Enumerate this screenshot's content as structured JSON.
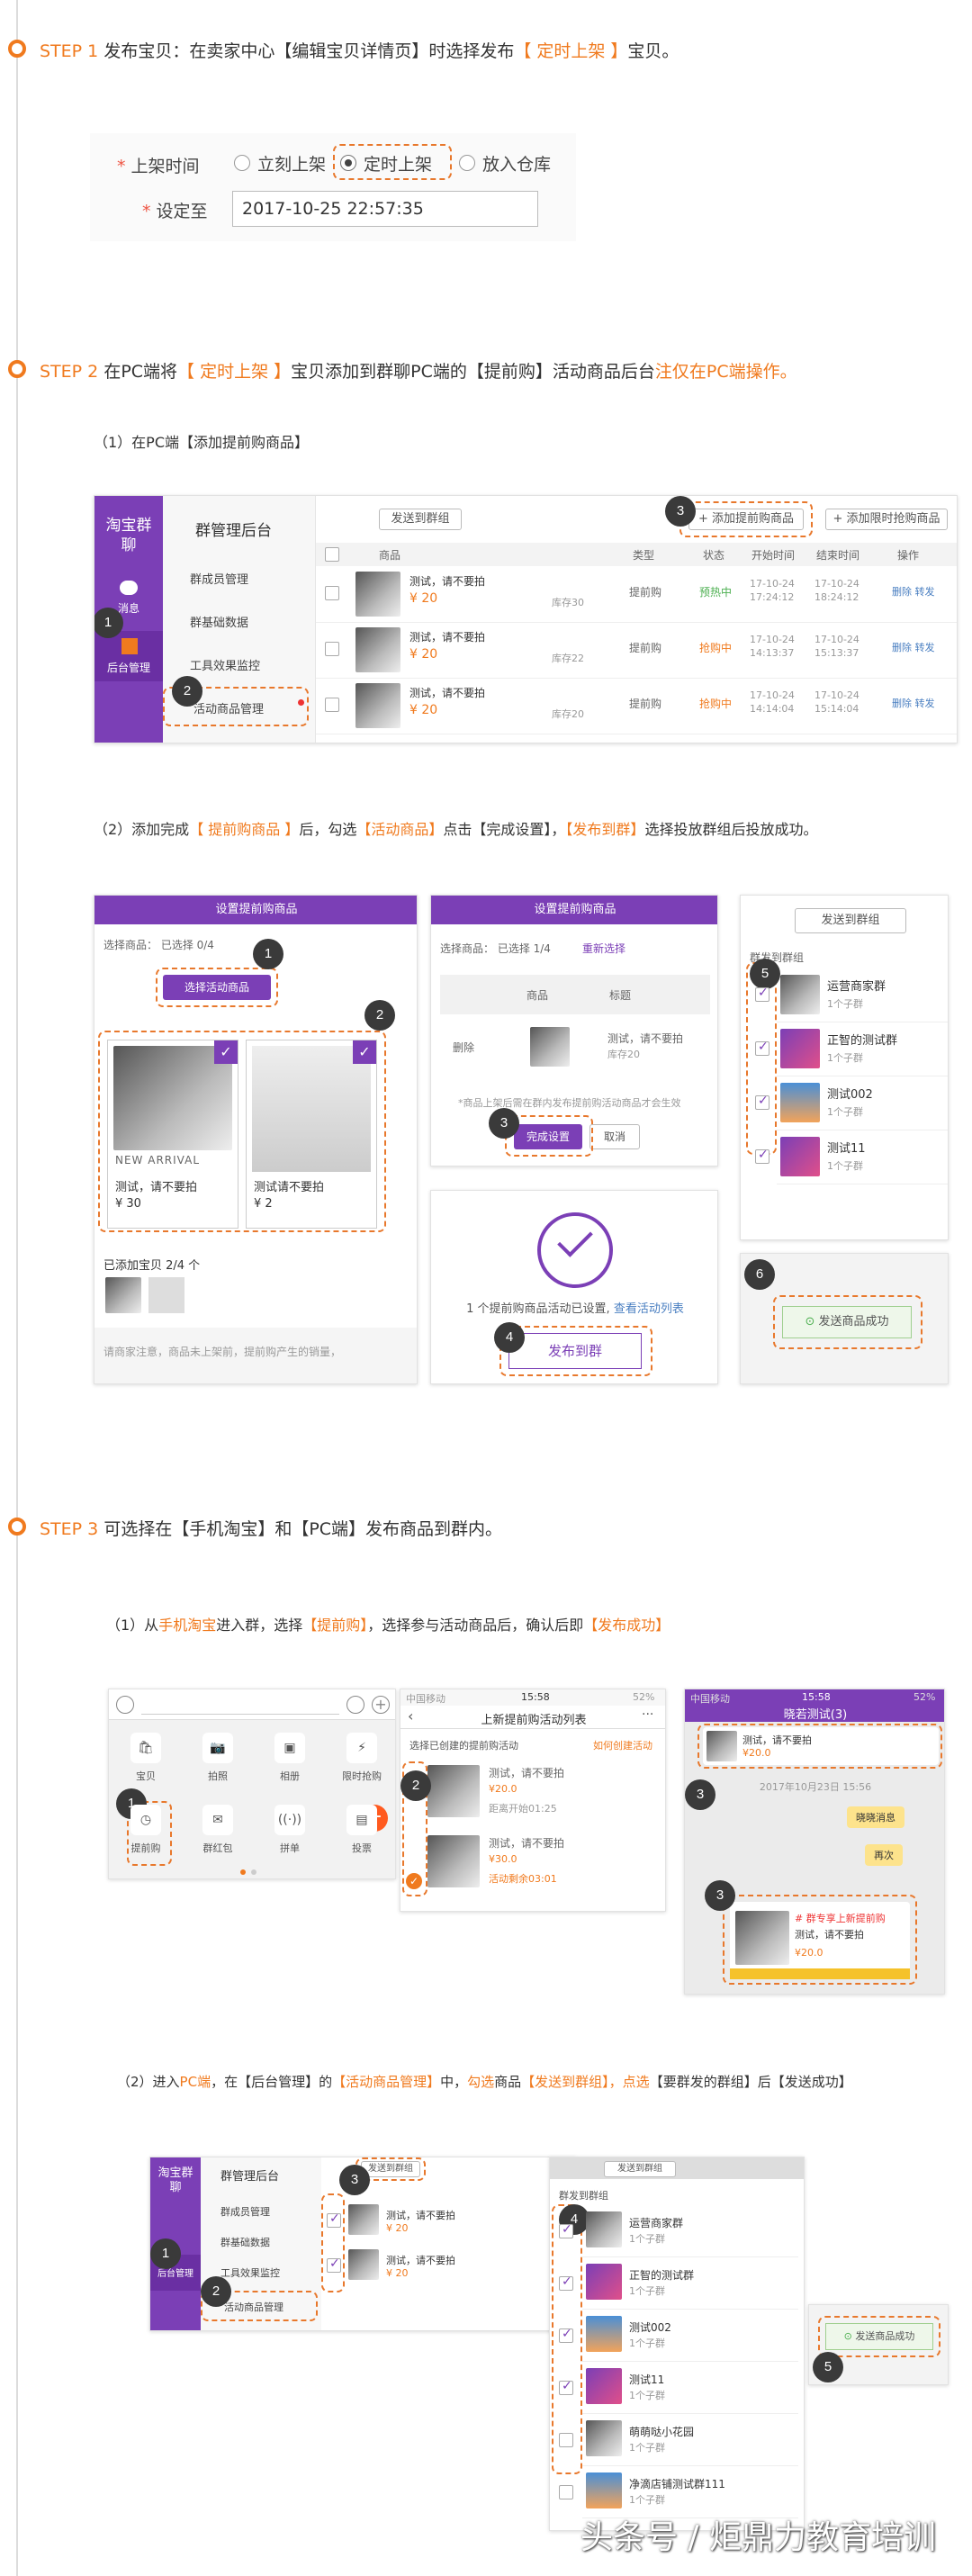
{
  "steps": [
    {
      "label": "STEP 1",
      "text_a": "发布宝贝：在卖家中心【编辑宝贝详情页】时选择发布",
      "highlight": "【 定时上架 】",
      "text_b": "宝贝。"
    },
    {
      "label": "STEP 2",
      "text_a": "在PC端将",
      "highlight": "【 定时上架 】",
      "text_b": "宝贝添加到群聊PC端的【提前购】活动商品后台",
      "note": "注仅在PC端操作。"
    },
    {
      "label": "STEP 3",
      "text": "可选择在【手机淘宝】和【PC端】发布商品到群内。"
    }
  ],
  "step1_form": {
    "shelf_label": "上架时间",
    "opt_now": "立刻上架",
    "opt_timed": "定时上架",
    "opt_store": "放入仓库",
    "set_label": "设定至",
    "datetime": "2017-10-25 22:57:35"
  },
  "step2": {
    "sub1": "（1）在PC端【添加提前购商品】",
    "sub2_a": "（2）添加完成",
    "sub2_h1": "【 提前购商品 】",
    "sub2_b": "后，勾选",
    "sub2_h2": "【活动商品】",
    "sub2_c": "点击【完成设置】，",
    "sub2_h3": "【发布到群】",
    "sub2_d": "选择投放群组后投放成功。"
  },
  "admin": {
    "logo": "淘宝群聊",
    "title": "群管理后台",
    "side_msg": "消息",
    "side_admin": "后台管理",
    "menu": [
      "群成员管理",
      "群基础数据",
      "工具效果监控",
      "活动商品管理"
    ],
    "btn_send": "发送到群组",
    "btn_add": "+ 添加提前购商品",
    "btn_add_flash": "+ 添加限时抢购商品",
    "cols": [
      "商品",
      "类型",
      "状态",
      "开始时间",
      "结束时间",
      "操作"
    ],
    "rows": [
      {
        "name": "测试，请不要拍",
        "price": "¥ 20",
        "stock": "库存30",
        "type": "提前购",
        "status": "预热中",
        "start": "17-10-24 17:24:12",
        "end": "17-10-24 18:24:12",
        "ops": "删除 转发"
      },
      {
        "name": "测试，请不要拍",
        "price": "¥ 20",
        "stock": "库存22",
        "type": "提前购",
        "status": "抢购中",
        "start": "17-10-24 14:13:37",
        "end": "17-10-24 15:13:37",
        "ops": "删除 转发"
      },
      {
        "name": "测试，请不要拍",
        "price": "¥ 20",
        "stock": "库存20",
        "type": "提前购",
        "status": "抢购中",
        "start": "17-10-24 14:14:04",
        "end": "17-10-24 15:14:04",
        "ops": "删除 转发"
      }
    ]
  },
  "setup": {
    "header": "设置提前购商品",
    "selected": "选择商品： 已选择 0/4",
    "btn_select": "选择活动商品",
    "p1_name": "测试，请不要拍",
    "p1_price": "¥ 30",
    "p1_tag": "NEW ARRIVAL",
    "p2_name": "测试请不要拍",
    "p2_price": "¥ 2",
    "added": "已添加宝贝 2/4 个",
    "notice": "请商家注意，商品未上架前，提前购产生的销量，",
    "selected2": "选择商品：  已选择 1/4",
    "reselect": "重新选择",
    "col_goods": "商品",
    "col_title": "标题",
    "row_del": "删除",
    "row_title": "测试，请不要拍",
    "row_stock": "库存20",
    "hint": "*商品上架后需在群内发布提前购活动商品才会生效",
    "btn_done": "完成设置",
    "btn_cancel": "取消",
    "success_text": "1 个提前购商品活动已设置,",
    "success_link": "查看活动列表",
    "btn_publish": "发布到群"
  },
  "group_panel": {
    "header": "发送到群组",
    "title": "群发到群组",
    "groups": [
      {
        "name": "运营商家群",
        "count": "1个子群"
      },
      {
        "name": "正智的测试群",
        "count": "1个子群"
      },
      {
        "name": "测试002",
        "count": "1个子群"
      },
      {
        "name": "测试11",
        "count": "1个子群"
      }
    ],
    "success": "发送商品成功"
  },
  "step3": {
    "sub1_a": "（1）从",
    "sub1_h1": "手机淘宝",
    "sub1_b": "进入群，选择",
    "sub1_h2": "【提前购】",
    "sub1_c": "，选择参与活动商品后，确认后即",
    "sub1_h3": "【发布成功】",
    "sub2_a": "（2）进入",
    "sub2_h1": "PC端",
    "sub2_b": "，在【后台管理】的",
    "sub2_h2": "【活动商品管理】",
    "sub2_c": "中，",
    "sub2_h3": "勾选",
    "sub2_d": "商品",
    "sub2_h4": "【发送到群组】",
    "sub2_e": "，点选",
    "sub2_f": "【要群发的群组】后【发送成功】"
  },
  "mobile": {
    "tools": [
      "宝贝",
      "拍照",
      "相册",
      "限时抢购",
      "提前购",
      "群红包",
      "拼单",
      "投票"
    ],
    "list_title": "上新提前购活动列表",
    "list_sub": "选择已创建的提前购活动",
    "list_link": "如何创建活动",
    "item_name": "测试，请不要拍",
    "item_price1": "¥20.0",
    "item_time1": "距离开始01:25",
    "item_price2": "¥30.0",
    "item_time2": "活动剩余03:01",
    "status_carrier": "中国移动",
    "status_time": "15:58",
    "status_battery": "52%",
    "chat_title": "晓若测试(3)",
    "chat_price": "¥20.0",
    "chat_date": "2017年10月23日 15:56",
    "bubble1": "晓晓消息",
    "bubble2": "再次",
    "card_tag": "# 群专享上新提前购",
    "card_name": "测试，请不要拍",
    "card_price": "¥20.0"
  },
  "step3_pc": {
    "groups": [
      {
        "name": "运营商家群",
        "count": "1个子群"
      },
      {
        "name": "正智的测试群",
        "count": "1个子群"
      },
      {
        "name": "测试002",
        "count": "1个子群"
      },
      {
        "name": "测试11",
        "count": "1个子群"
      },
      {
        "name": "萌萌哒小花园",
        "count": "1个子群"
      },
      {
        "name": "净滴店铺测试群111",
        "count": "1个子群"
      }
    ]
  },
  "watermark": "头条号 / 炬鼎力教育培训"
}
